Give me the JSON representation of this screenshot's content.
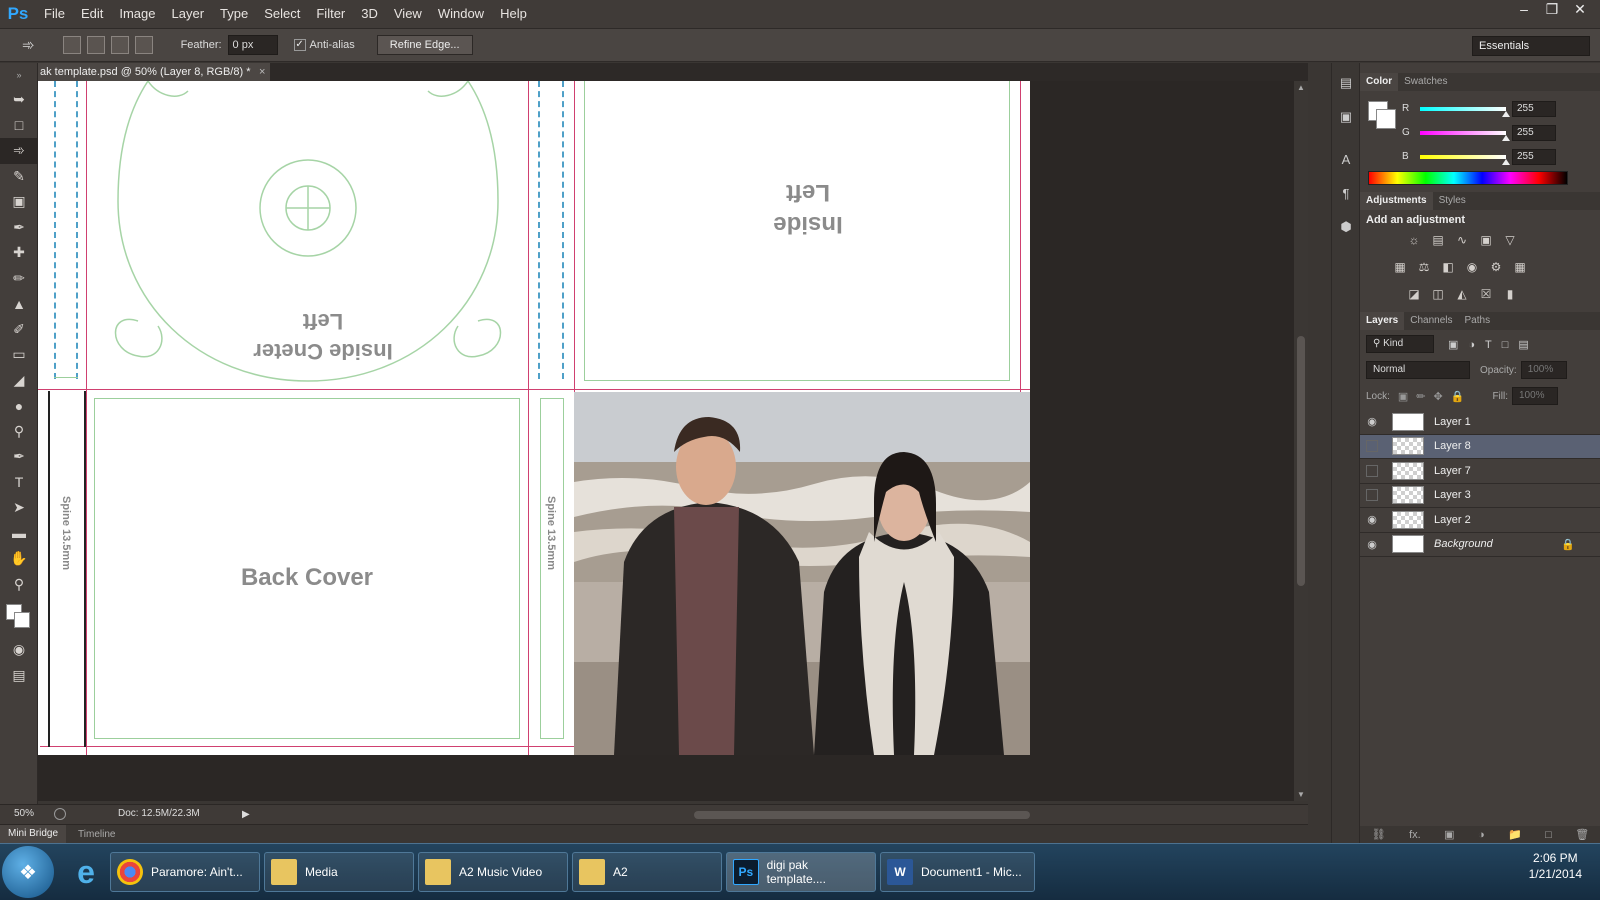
{
  "app": {
    "logo": "Ps"
  },
  "menu": [
    "File",
    "Edit",
    "Image",
    "Layer",
    "Type",
    "Select",
    "Filter",
    "3D",
    "View",
    "Window",
    "Help"
  ],
  "window_controls": [
    "minimize-icon",
    "restore-icon",
    "close-icon"
  ],
  "options_bar": {
    "feather_label": "Feather:",
    "feather_value": "0 px",
    "antialias_label": "Anti-alias",
    "antialias_checked": true,
    "refine_edge_label": "Refine Edge...",
    "workspace": "Essentials"
  },
  "document_tab": {
    "title": "ak template.psd @ 50% (Layer 8, RGB/8) *"
  },
  "canvas": {
    "inside_center_line1": "Inside Cneter",
    "inside_center_line2": "Left",
    "inside_left_line1": "Inside",
    "inside_left_line2": "Left",
    "back_cover": "Back Cover",
    "spine_left": "Spine 13.5mm",
    "spine_right": "Spine 13.5mm",
    "photo_alt": "Photo of a young man and woman standing on a beach"
  },
  "status_bar": {
    "zoom": "50%",
    "doc_size": "Doc: 12.5M/22.3M"
  },
  "bottom_tabs": {
    "mini_bridge": "Mini Bridge",
    "timeline": "Timeline"
  },
  "color_panel": {
    "tabs": [
      "Color",
      "Swatches"
    ],
    "r_label": "R",
    "r_value": "255",
    "g_label": "G",
    "g_value": "255",
    "b_label": "B",
    "b_value": "255"
  },
  "adjustments_panel": {
    "tabs": [
      "Adjustments",
      "Styles"
    ],
    "title": "Add an adjustment"
  },
  "layers_panel": {
    "tabs": [
      "Layers",
      "Channels",
      "Paths"
    ],
    "kind_label": "Kind",
    "blend_mode": "Normal",
    "opacity_label": "Opacity:",
    "opacity_value": "100%",
    "lock_label": "Lock:",
    "fill_label": "Fill:",
    "fill_value": "100%",
    "layers": [
      {
        "name": "Layer 1",
        "visible": true,
        "selected": false
      },
      {
        "name": "Layer 8",
        "visible": false,
        "selected": true
      },
      {
        "name": "Layer 7",
        "visible": false,
        "selected": false
      },
      {
        "name": "Layer 3",
        "visible": false,
        "selected": false
      },
      {
        "name": "Layer 2",
        "visible": true,
        "selected": false
      },
      {
        "name": "Background",
        "visible": true,
        "selected": false,
        "locked": true
      }
    ]
  },
  "taskbar": {
    "items": [
      {
        "label": "Paramore: Ain't...",
        "icon": "chrome-icon"
      },
      {
        "label": "Media",
        "icon": "folder-icon"
      },
      {
        "label": "A2 Music Video",
        "icon": "folder-icon"
      },
      {
        "label": "A2",
        "icon": "folder-icon"
      },
      {
        "label": "digi pak template....",
        "icon": "photoshop-icon"
      },
      {
        "label": "Document1 - Mic...",
        "icon": "word-icon"
      }
    ],
    "time": "2:06 PM",
    "date": "1/21/2014"
  }
}
